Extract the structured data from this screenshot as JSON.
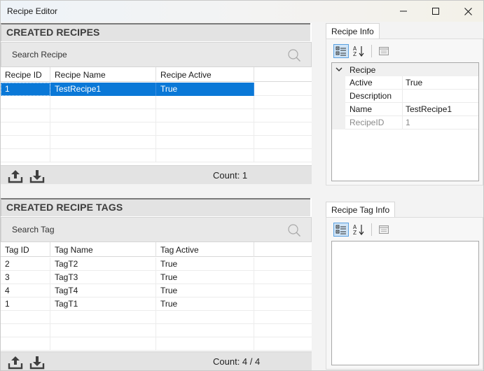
{
  "window": {
    "title": "Recipe Editor"
  },
  "recipes_panel": {
    "header": "CREATED RECIPES",
    "search_placeholder": "Search Recipe",
    "columns": [
      "Recipe ID",
      "Recipe Name",
      "Recipe Active"
    ],
    "rows": [
      {
        "id": "1",
        "name": "TestRecipe1",
        "active": "True",
        "selected": true
      }
    ],
    "count": "Count: 1",
    "icons": [
      "upload-icon",
      "download-icon",
      "search-icon"
    ]
  },
  "tags_panel": {
    "header": "CREATED RECIPE TAGS",
    "search_placeholder": "Search Tag",
    "columns": [
      "Tag ID",
      "Tag Name",
      "Tag Active"
    ],
    "rows": [
      {
        "id": "2",
        "name": "TagT2",
        "active": "True"
      },
      {
        "id": "3",
        "name": "TagT3",
        "active": "True"
      },
      {
        "id": "4",
        "name": "TagT4",
        "active": "True"
      },
      {
        "id": "1",
        "name": "TagT1",
        "active": "True"
      }
    ],
    "count": "Count: 4 / 4",
    "icons": [
      "upload-icon",
      "download-icon",
      "search-icon"
    ]
  },
  "recipe_info": {
    "tab_label": "Recipe Info",
    "category": "Recipe",
    "properties": [
      {
        "name": "Active",
        "value": "True",
        "readonly": false
      },
      {
        "name": "Description",
        "value": "",
        "readonly": false
      },
      {
        "name": "Name",
        "value": "TestRecipe1",
        "readonly": false
      },
      {
        "name": "RecipeID",
        "value": "1",
        "readonly": true
      }
    ],
    "toolbar_icons": [
      "categorized-icon",
      "alphabetical-sort-icon",
      "property-pages-icon"
    ]
  },
  "recipe_tag_info": {
    "tab_label": "Recipe Tag Info",
    "toolbar_icons": [
      "categorized-icon",
      "alphabetical-sort-icon",
      "property-pages-icon"
    ]
  },
  "colors": {
    "selection": "#0a78d7",
    "header_bg": "#e3e3e3",
    "toolbar_active": "#cfe4f7"
  }
}
